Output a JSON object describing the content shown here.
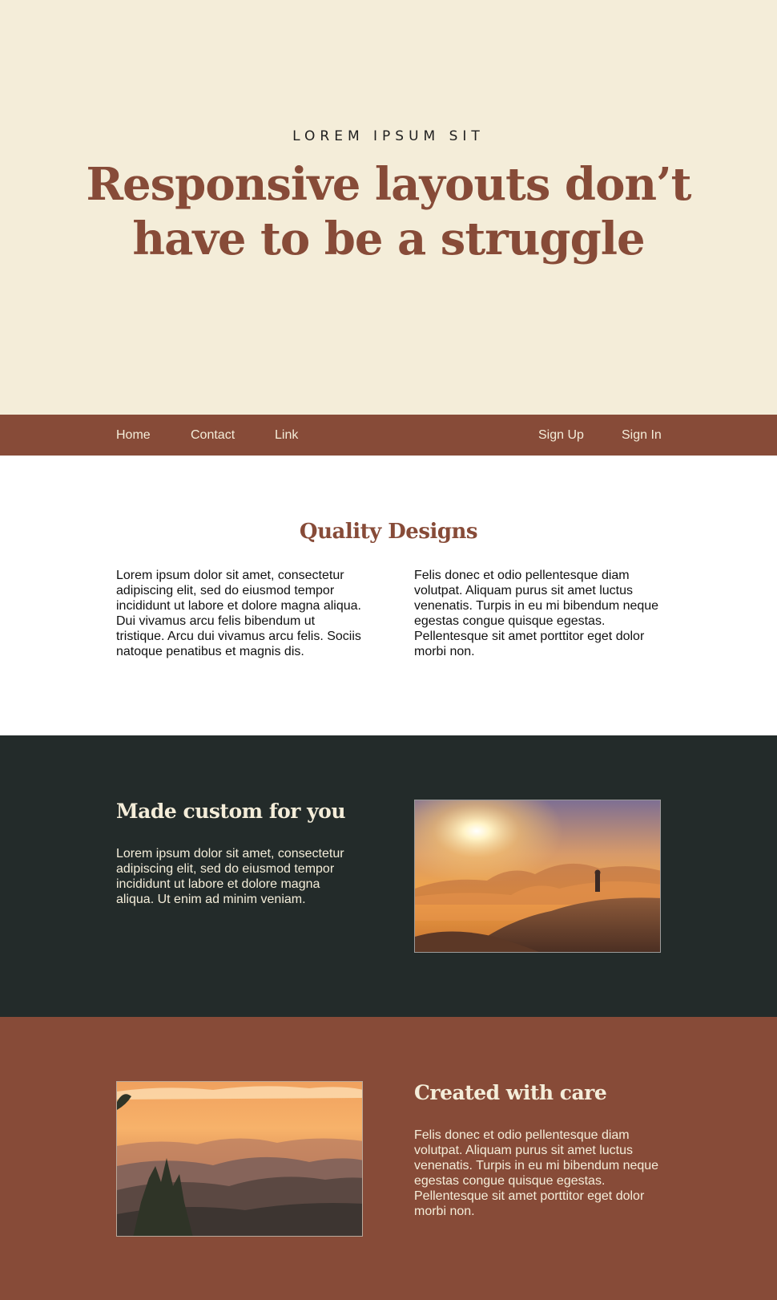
{
  "hero": {
    "eyebrow": "LOREM IPSUM SIT",
    "title_line1": "Responsive layouts don’t",
    "title_line2": "have to be a struggle"
  },
  "nav": {
    "left": [
      {
        "label": "Home"
      },
      {
        "label": "Contact"
      },
      {
        "label": "Link"
      }
    ],
    "right": [
      {
        "label": "Sign Up"
      },
      {
        "label": "Sign In"
      }
    ]
  },
  "quality": {
    "title": "Quality Designs",
    "col1": "Lorem ipsum dolor sit amet, consectetur adipiscing elit, sed do eiusmod tempor incididunt ut labore et dolore magna aliqua. Dui vivamus arcu felis bibendum ut tristique. Arcu dui vivamus arcu felis. Sociis natoque penatibus et magnis dis.",
    "col2": "Felis donec et odio pellentesque diam volutpat. Aliquam purus sit amet luctus venenatis. Turpis in eu mi bibendum neque egestas congue quisque egestas. Pellentesque sit amet porttitor eget dolor morbi non."
  },
  "custom": {
    "title": "Made custom for you",
    "text": "Lorem ipsum dolor sit amet, consectetur adipiscing elit, sed do eiusmod tempor incididunt ut labore et dolore magna aliqua. Ut enim ad minim veniam.",
    "image": "sunrise-mountain-hiker-photo"
  },
  "care": {
    "title": "Created with care",
    "text": "Felis donec et odio pellentesque diam volutpat. Aliquam purus sit amet luctus venenatis. Turpis in eu mi bibendum neque egestas congue quisque egestas. Pellentesque sit amet porttitor eget dolor morbi non.",
    "image": "sunset-mountain-ridges-photo"
  },
  "colors": {
    "cream": "#f4edd9",
    "brown": "#874b38",
    "dark": "#232b2a"
  }
}
